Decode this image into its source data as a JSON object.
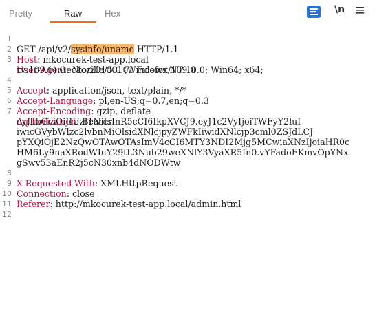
{
  "tabs": {
    "pretty": "Pretty",
    "raw": "Raw",
    "hex": "Hex",
    "newline": "\\n"
  },
  "colors": {
    "accent": "#f26a1b",
    "header_name": "#b1143f",
    "highlight": "#f6b66e",
    "format_icon": "#2b73d1"
  },
  "icons": [
    "format-icon",
    "newline-icon",
    "menu-icon"
  ],
  "request": {
    "line_numbers": [
      "1",
      "2",
      "3",
      "4",
      "5",
      "6",
      "7",
      "8",
      "9",
      "10",
      "11",
      "12"
    ],
    "request_line": {
      "before": "GET /api/v2/",
      "highlight": "sysinfo/uname",
      "after": " HTTP/1.1"
    },
    "host": {
      "name": "Host",
      "value": "mkocurek-test-app.local"
    },
    "user_agent": {
      "name": "User-Agent",
      "value_1": "Mozilla/5.0 (Windows NT 10.0; Win64; x64;",
      "value_2": "rv:109.0) Gecko/20100101 Firefox/109.0"
    },
    "accept": {
      "name": "Accept",
      "value": "application/json, text/plain, */*"
    },
    "accept_language": {
      "name": "Accept-Language",
      "value": "pl,en-US;q=0.7,en;q=0.3"
    },
    "accept_encoding": {
      "name": "Accept-Encoding",
      "value": "gzip, deflate"
    },
    "authorization": {
      "name": "Authorization",
      "value_1": "Bearer",
      "token_1": "eyJhbGciOiJIUzI1NiIsInR5cCI6IkpXVCJ9.eyJ1c2VyIjoiTWFyY2luI",
      "token_2": "iwicGVybWlzc2lvbnMiOlsidXNlcjpyZWFkIiwidXNlcjp3cml0ZSJdLCJ",
      "token_3": "pYXQiOjE2NzQwOTAwOTAsImV4cCI6MTY3NDI2Mjg5MCwiaXNzIjoiaHR0c",
      "token_4": "HM6Ly9naXRodWIuY29tL3Nub29weXNlY3VyaXR5In0.vYFadoEKmvOpYNx",
      "token_5": "gSwv53aEnR2j5cN30xnb4dNODWtw"
    },
    "x_requested_with": {
      "name": "X-Requested-With",
      "value": "XMLHttpRequest"
    },
    "connection": {
      "name": "Connection",
      "value": "close"
    },
    "referer": {
      "name": "Referer",
      "value": "http://mkocurek-test-app.local/admin.html"
    }
  }
}
